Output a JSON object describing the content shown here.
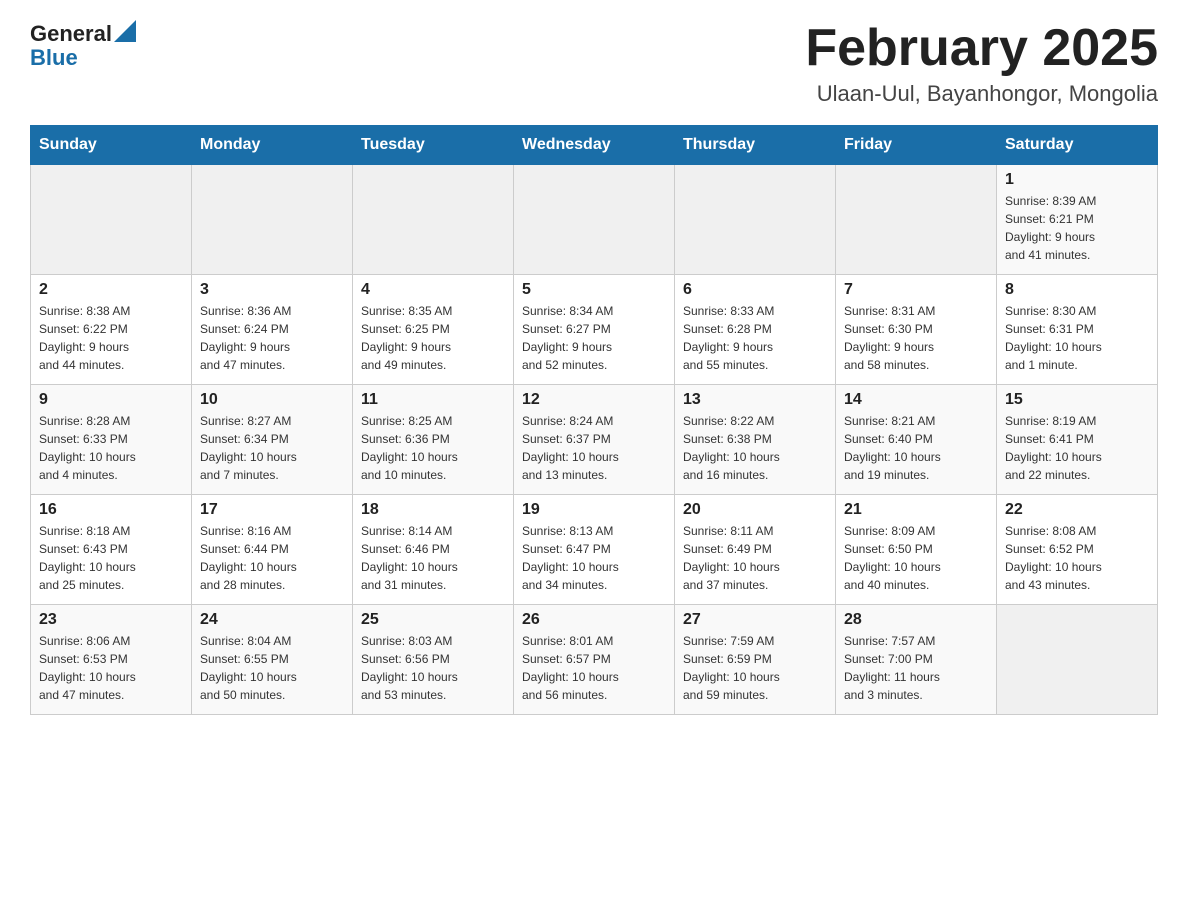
{
  "header": {
    "logo_general": "General",
    "logo_blue": "Blue",
    "month_title": "February 2025",
    "location": "Ulaan-Uul, Bayanhongor, Mongolia"
  },
  "weekdays": [
    "Sunday",
    "Monday",
    "Tuesday",
    "Wednesday",
    "Thursday",
    "Friday",
    "Saturday"
  ],
  "weeks": [
    [
      {
        "day": "",
        "info": ""
      },
      {
        "day": "",
        "info": ""
      },
      {
        "day": "",
        "info": ""
      },
      {
        "day": "",
        "info": ""
      },
      {
        "day": "",
        "info": ""
      },
      {
        "day": "",
        "info": ""
      },
      {
        "day": "1",
        "info": "Sunrise: 8:39 AM\nSunset: 6:21 PM\nDaylight: 9 hours\nand 41 minutes."
      }
    ],
    [
      {
        "day": "2",
        "info": "Sunrise: 8:38 AM\nSunset: 6:22 PM\nDaylight: 9 hours\nand 44 minutes."
      },
      {
        "day": "3",
        "info": "Sunrise: 8:36 AM\nSunset: 6:24 PM\nDaylight: 9 hours\nand 47 minutes."
      },
      {
        "day": "4",
        "info": "Sunrise: 8:35 AM\nSunset: 6:25 PM\nDaylight: 9 hours\nand 49 minutes."
      },
      {
        "day": "5",
        "info": "Sunrise: 8:34 AM\nSunset: 6:27 PM\nDaylight: 9 hours\nand 52 minutes."
      },
      {
        "day": "6",
        "info": "Sunrise: 8:33 AM\nSunset: 6:28 PM\nDaylight: 9 hours\nand 55 minutes."
      },
      {
        "day": "7",
        "info": "Sunrise: 8:31 AM\nSunset: 6:30 PM\nDaylight: 9 hours\nand 58 minutes."
      },
      {
        "day": "8",
        "info": "Sunrise: 8:30 AM\nSunset: 6:31 PM\nDaylight: 10 hours\nand 1 minute."
      }
    ],
    [
      {
        "day": "9",
        "info": "Sunrise: 8:28 AM\nSunset: 6:33 PM\nDaylight: 10 hours\nand 4 minutes."
      },
      {
        "day": "10",
        "info": "Sunrise: 8:27 AM\nSunset: 6:34 PM\nDaylight: 10 hours\nand 7 minutes."
      },
      {
        "day": "11",
        "info": "Sunrise: 8:25 AM\nSunset: 6:36 PM\nDaylight: 10 hours\nand 10 minutes."
      },
      {
        "day": "12",
        "info": "Sunrise: 8:24 AM\nSunset: 6:37 PM\nDaylight: 10 hours\nand 13 minutes."
      },
      {
        "day": "13",
        "info": "Sunrise: 8:22 AM\nSunset: 6:38 PM\nDaylight: 10 hours\nand 16 minutes."
      },
      {
        "day": "14",
        "info": "Sunrise: 8:21 AM\nSunset: 6:40 PM\nDaylight: 10 hours\nand 19 minutes."
      },
      {
        "day": "15",
        "info": "Sunrise: 8:19 AM\nSunset: 6:41 PM\nDaylight: 10 hours\nand 22 minutes."
      }
    ],
    [
      {
        "day": "16",
        "info": "Sunrise: 8:18 AM\nSunset: 6:43 PM\nDaylight: 10 hours\nand 25 minutes."
      },
      {
        "day": "17",
        "info": "Sunrise: 8:16 AM\nSunset: 6:44 PM\nDaylight: 10 hours\nand 28 minutes."
      },
      {
        "day": "18",
        "info": "Sunrise: 8:14 AM\nSunset: 6:46 PM\nDaylight: 10 hours\nand 31 minutes."
      },
      {
        "day": "19",
        "info": "Sunrise: 8:13 AM\nSunset: 6:47 PM\nDaylight: 10 hours\nand 34 minutes."
      },
      {
        "day": "20",
        "info": "Sunrise: 8:11 AM\nSunset: 6:49 PM\nDaylight: 10 hours\nand 37 minutes."
      },
      {
        "day": "21",
        "info": "Sunrise: 8:09 AM\nSunset: 6:50 PM\nDaylight: 10 hours\nand 40 minutes."
      },
      {
        "day": "22",
        "info": "Sunrise: 8:08 AM\nSunset: 6:52 PM\nDaylight: 10 hours\nand 43 minutes."
      }
    ],
    [
      {
        "day": "23",
        "info": "Sunrise: 8:06 AM\nSunset: 6:53 PM\nDaylight: 10 hours\nand 47 minutes."
      },
      {
        "day": "24",
        "info": "Sunrise: 8:04 AM\nSunset: 6:55 PM\nDaylight: 10 hours\nand 50 minutes."
      },
      {
        "day": "25",
        "info": "Sunrise: 8:03 AM\nSunset: 6:56 PM\nDaylight: 10 hours\nand 53 minutes."
      },
      {
        "day": "26",
        "info": "Sunrise: 8:01 AM\nSunset: 6:57 PM\nDaylight: 10 hours\nand 56 minutes."
      },
      {
        "day": "27",
        "info": "Sunrise: 7:59 AM\nSunset: 6:59 PM\nDaylight: 10 hours\nand 59 minutes."
      },
      {
        "day": "28",
        "info": "Sunrise: 7:57 AM\nSunset: 7:00 PM\nDaylight: 11 hours\nand 3 minutes."
      },
      {
        "day": "",
        "info": ""
      }
    ]
  ]
}
